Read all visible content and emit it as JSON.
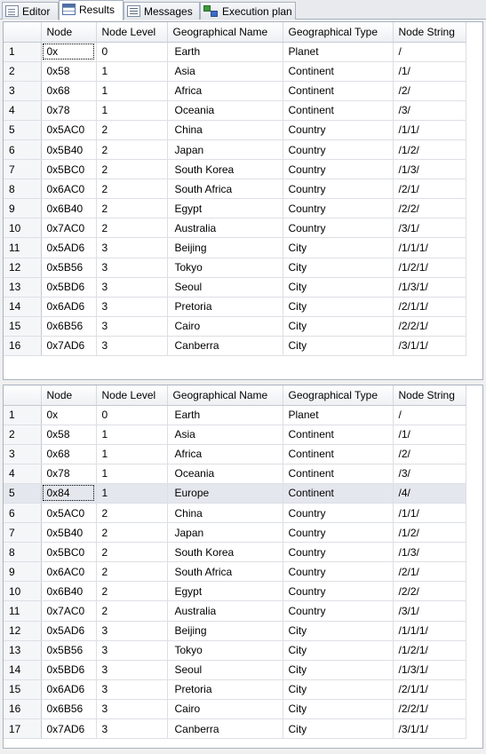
{
  "tabs": [
    {
      "label": "Editor",
      "icon": "editor-icon",
      "active": false
    },
    {
      "label": "Results",
      "icon": "results-grid-icon",
      "active": true
    },
    {
      "label": "Messages",
      "icon": "messages-icon",
      "active": false
    },
    {
      "label": "Execution plan",
      "icon": "execution-plan-icon",
      "active": false
    }
  ],
  "columns": [
    "Node",
    "Node Level",
    "Geographical Name",
    "Geographical Type",
    "Node String"
  ],
  "grid1": {
    "rows": [
      [
        "1",
        "0x",
        "0",
        "Earth",
        "Planet",
        "/"
      ],
      [
        "2",
        "0x58",
        "1",
        "Asia",
        "Continent",
        "/1/"
      ],
      [
        "3",
        "0x68",
        "1",
        "Africa",
        "Continent",
        "/2/"
      ],
      [
        "4",
        "0x78",
        "1",
        "Oceania",
        "Continent",
        "/3/"
      ],
      [
        "5",
        "0x5AC0",
        "2",
        "China",
        "Country",
        "/1/1/"
      ],
      [
        "6",
        "0x5B40",
        "2",
        "Japan",
        "Country",
        "/1/2/"
      ],
      [
        "7",
        "0x5BC0",
        "2",
        "South Korea",
        "Country",
        "/1/3/"
      ],
      [
        "8",
        "0x6AC0",
        "2",
        "South Africa",
        "Country",
        "/2/1/"
      ],
      [
        "9",
        "0x6B40",
        "2",
        "Egypt",
        "Country",
        "/2/2/"
      ],
      [
        "10",
        "0x7AC0",
        "2",
        "Australia",
        "Country",
        "/3/1/"
      ],
      [
        "11",
        "0x5AD6",
        "3",
        "Beijing",
        "City",
        "/1/1/1/"
      ],
      [
        "12",
        "0x5B56",
        "3",
        "Tokyo",
        "City",
        "/1/2/1/"
      ],
      [
        "13",
        "0x5BD6",
        "3",
        "Seoul",
        "City",
        "/1/3/1/"
      ],
      [
        "14",
        "0x6AD6",
        "3",
        "Pretoria",
        "City",
        "/2/1/1/"
      ],
      [
        "15",
        "0x6B56",
        "3",
        "Cairo",
        "City",
        "/2/2/1/"
      ],
      [
        "16",
        "0x7AD6",
        "3",
        "Canberra",
        "City",
        "/3/1/1/"
      ]
    ],
    "focused_cell": [
      0,
      1
    ]
  },
  "grid2": {
    "rows": [
      [
        "1",
        "0x",
        "0",
        "Earth",
        "Planet",
        "/"
      ],
      [
        "2",
        "0x58",
        "1",
        "Asia",
        "Continent",
        "/1/"
      ],
      [
        "3",
        "0x68",
        "1",
        "Africa",
        "Continent",
        "/2/"
      ],
      [
        "4",
        "0x78",
        "1",
        "Oceania",
        "Continent",
        "/3/"
      ],
      [
        "5",
        "0x84",
        "1",
        "Europe",
        "Continent",
        "/4/"
      ],
      [
        "6",
        "0x5AC0",
        "2",
        "China",
        "Country",
        "/1/1/"
      ],
      [
        "7",
        "0x5B40",
        "2",
        "Japan",
        "Country",
        "/1/2/"
      ],
      [
        "8",
        "0x5BC0",
        "2",
        "South Korea",
        "Country",
        "/1/3/"
      ],
      [
        "9",
        "0x6AC0",
        "2",
        "South Africa",
        "Country",
        "/2/1/"
      ],
      [
        "10",
        "0x6B40",
        "2",
        "Egypt",
        "Country",
        "/2/2/"
      ],
      [
        "11",
        "0x7AC0",
        "2",
        "Australia",
        "Country",
        "/3/1/"
      ],
      [
        "12",
        "0x5AD6",
        "3",
        "Beijing",
        "City",
        "/1/1/1/"
      ],
      [
        "13",
        "0x5B56",
        "3",
        "Tokyo",
        "City",
        "/1/2/1/"
      ],
      [
        "14",
        "0x5BD6",
        "3",
        "Seoul",
        "City",
        "/1/3/1/"
      ],
      [
        "15",
        "0x6AD6",
        "3",
        "Pretoria",
        "City",
        "/2/1/1/"
      ],
      [
        "16",
        "0x6B56",
        "3",
        "Cairo",
        "City",
        "/2/2/1/"
      ],
      [
        "17",
        "0x7AD6",
        "3",
        "Canberra",
        "City",
        "/3/1/1/"
      ]
    ],
    "selected_row": 4,
    "focused_cell": [
      4,
      1
    ]
  }
}
